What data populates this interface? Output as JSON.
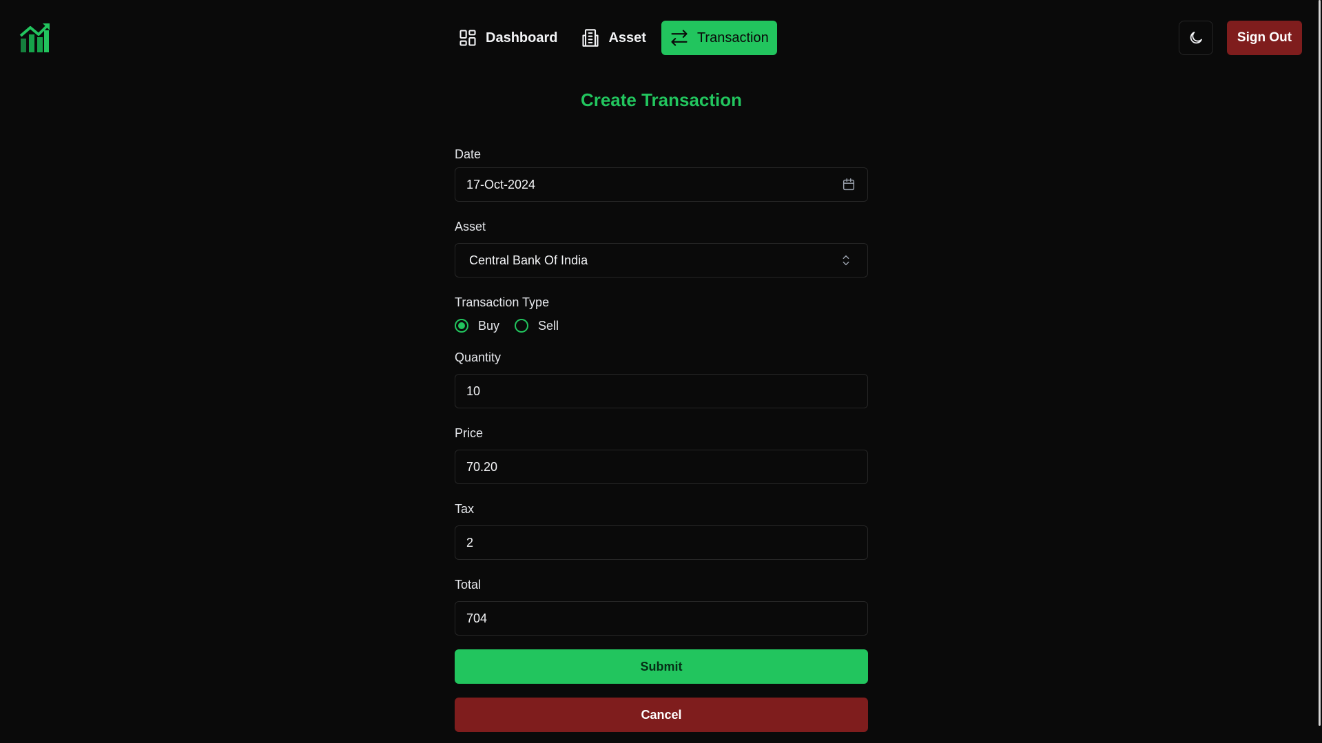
{
  "colors": {
    "background": "#0a0a0a",
    "accent": "#22c55e",
    "danger": "#7f1d1d",
    "border": "#262626"
  },
  "header": {
    "logo_icon": "chart-growth-icon",
    "nav": [
      {
        "label": "Dashboard",
        "icon": "dashboard-grid-icon",
        "active": false
      },
      {
        "label": "Asset",
        "icon": "building-icon",
        "active": false
      },
      {
        "label": "Transaction",
        "icon": "arrows-left-right-icon",
        "active": true
      }
    ],
    "theme_toggle_icon": "moon-icon",
    "sign_out_label": "Sign Out"
  },
  "form": {
    "title": "Create Transaction",
    "date": {
      "label": "Date",
      "value": "17-Oct-2024",
      "icon": "calendar-icon"
    },
    "asset": {
      "label": "Asset",
      "selected": "Central Bank Of India",
      "icon": "chevron-up-down-icon"
    },
    "transaction_type": {
      "label": "Transaction Type",
      "options": [
        "Buy",
        "Sell"
      ],
      "selected": "Buy"
    },
    "quantity": {
      "label": "Quantity",
      "value": "10"
    },
    "price": {
      "label": "Price",
      "value": "70.20"
    },
    "tax": {
      "label": "Tax",
      "value": "2"
    },
    "total": {
      "label": "Total",
      "value": "704"
    },
    "submit_label": "Submit",
    "cancel_label": "Cancel"
  }
}
